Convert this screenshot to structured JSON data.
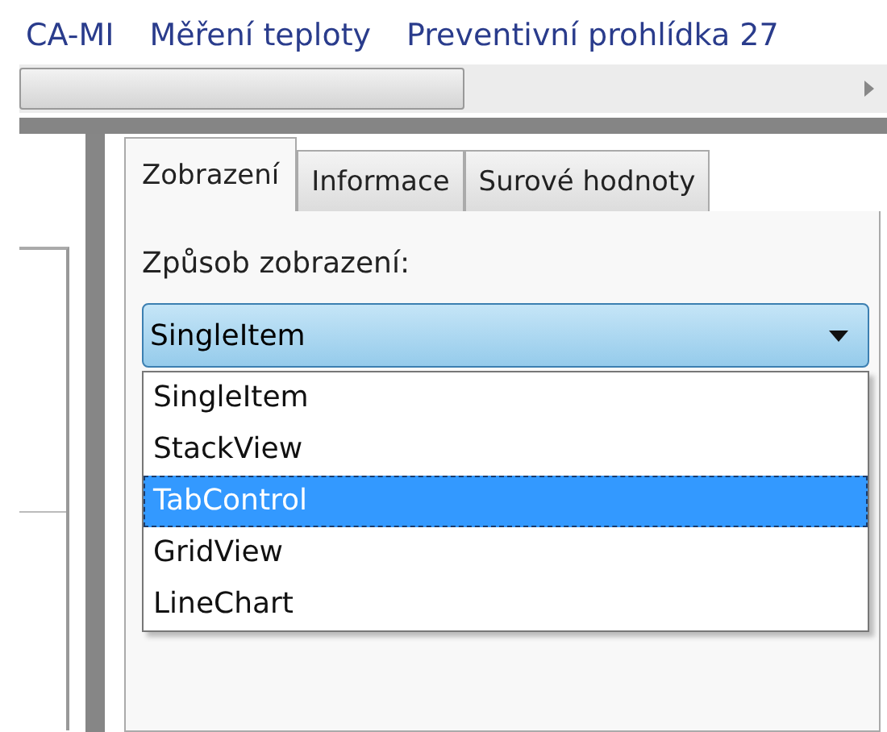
{
  "breadcrumbs": [
    "CA-MI",
    "Měření teploty",
    "Preventivní prohlídka 27"
  ],
  "tabs": [
    {
      "label": "Zobrazení",
      "selected": true
    },
    {
      "label": "Informace",
      "selected": false
    },
    {
      "label": "Surové hodnoty",
      "selected": false
    }
  ],
  "display_mode": {
    "label": "Způsob zobrazení:",
    "value": "SingleItem",
    "expanded": true,
    "options": [
      {
        "label": "SingleItem",
        "highlighted": false
      },
      {
        "label": "StackView",
        "highlighted": false
      },
      {
        "label": "TabControl",
        "highlighted": true
      },
      {
        "label": "GridView",
        "highlighted": false
      },
      {
        "label": "LineChart",
        "highlighted": false
      }
    ]
  }
}
